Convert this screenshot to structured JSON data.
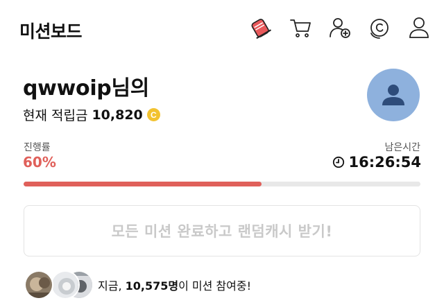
{
  "header": {
    "title": "미션보드",
    "icons": [
      "shoe-icon",
      "cart-icon",
      "add-friend-icon",
      "coin-icon",
      "profile-icon"
    ]
  },
  "profile": {
    "username": "qwwoip",
    "name_suffix": "님의",
    "points_label": "현재 적립금",
    "points_value": "10,820",
    "coin_symbol": "C"
  },
  "progress": {
    "label": "진행률",
    "percent_text": "60%",
    "percent_value": 0.6
  },
  "timer": {
    "label": "남은시간",
    "value": "16:26:54"
  },
  "reward_button": {
    "label": "모든 미션 완료하고 랜덤캐시 받기!"
  },
  "participants": {
    "prefix": "지금, ",
    "count": "10,575명",
    "suffix": "이 미션 참여중!"
  },
  "colors": {
    "accent": "#e0605a",
    "coin": "#f2c230",
    "avatar_bg": "#8eb1dd",
    "disabled_text": "#c9c9c9"
  }
}
